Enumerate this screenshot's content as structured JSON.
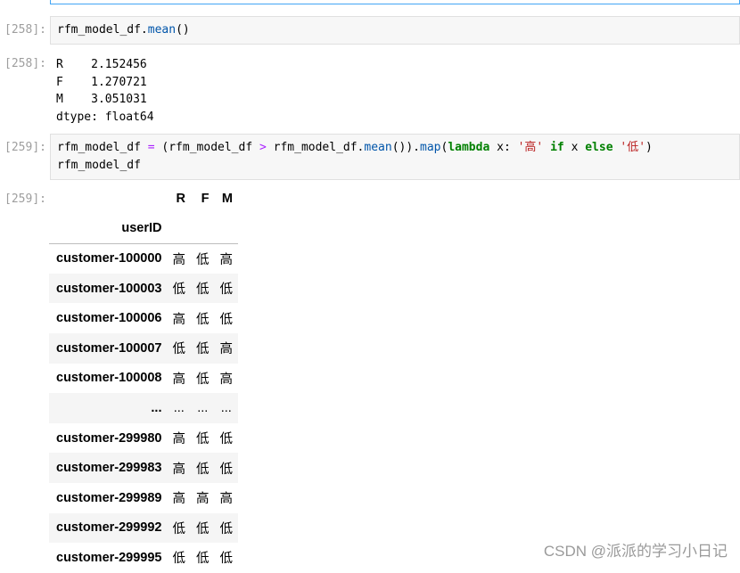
{
  "cells": [
    {
      "prompt": "[258]:",
      "code_line": "rfm_model_df.mean()"
    },
    {
      "out_prompt": "[258]:",
      "output_lines": [
        "R    2.152456",
        "F    1.270721",
        "M    3.051031",
        "dtype: float64"
      ]
    },
    {
      "prompt": "[259]:",
      "code_line2": "rfm_model_df"
    },
    {
      "out_prompt": "[259]:"
    }
  ],
  "code259": {
    "p1": "rfm_model_df ",
    "eq": "=",
    "p2": " (rfm_model_df ",
    "gt": ">",
    "p3": " rfm_model_df.",
    "mean": "mean",
    "p4": "()).",
    "map": "map",
    "p5": "(",
    "lambda": "lambda",
    "p6": " x: ",
    "s1": "'高'",
    "p7": " ",
    "if": "if",
    "p8": " x ",
    "else": "else",
    "p9": " ",
    "s2": "'低'",
    "p10": ")"
  },
  "code258": {
    "p1": "rfm_model_df.",
    "mean": "mean",
    "p2": "()"
  },
  "table": {
    "columns": [
      "R",
      "F",
      "M"
    ],
    "index_name": "userID",
    "rows": [
      {
        "index": "customer-100000",
        "R": "高",
        "F": "低",
        "M": "高"
      },
      {
        "index": "customer-100003",
        "R": "低",
        "F": "低",
        "M": "低"
      },
      {
        "index": "customer-100006",
        "R": "高",
        "F": "低",
        "M": "低"
      },
      {
        "index": "customer-100007",
        "R": "低",
        "F": "低",
        "M": "高"
      },
      {
        "index": "customer-100008",
        "R": "高",
        "F": "低",
        "M": "高"
      },
      {
        "index": "...",
        "R": "...",
        "F": "...",
        "M": "..."
      },
      {
        "index": "customer-299980",
        "R": "高",
        "F": "低",
        "M": "低"
      },
      {
        "index": "customer-299983",
        "R": "高",
        "F": "低",
        "M": "低"
      },
      {
        "index": "customer-299989",
        "R": "高",
        "F": "高",
        "M": "高"
      },
      {
        "index": "customer-299992",
        "R": "低",
        "F": "低",
        "M": "低"
      },
      {
        "index": "customer-299995",
        "R": "低",
        "F": "低",
        "M": "低"
      }
    ]
  },
  "watermark": "CSDN @派派的学习小日记"
}
